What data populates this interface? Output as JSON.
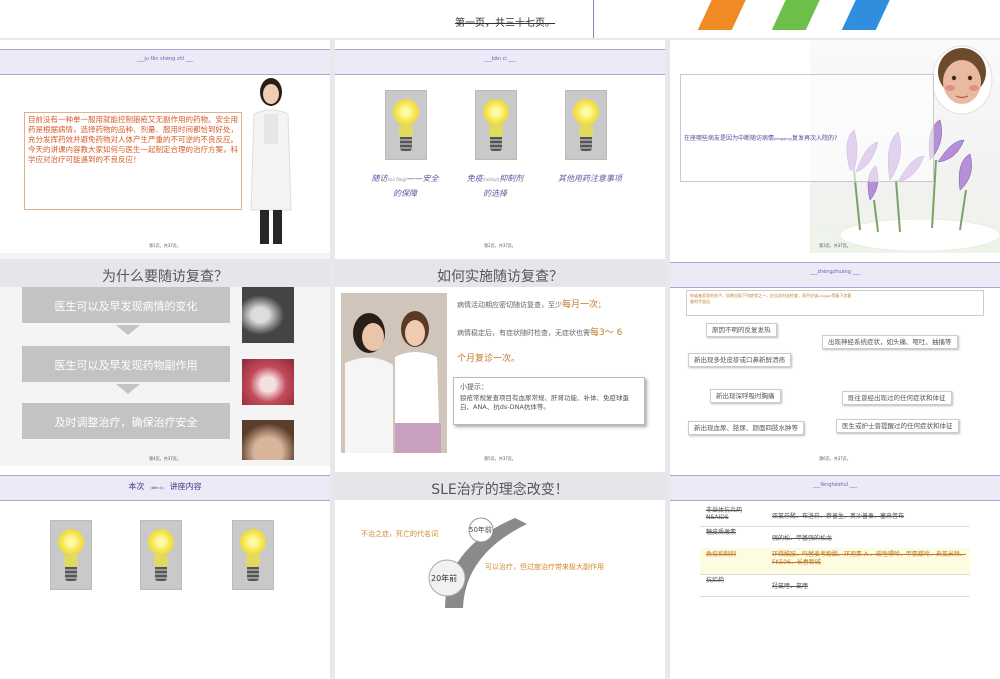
{
  "top": {
    "title": "第一页，共三十七页。"
  },
  "colors": {
    "accent_purple": "#6b63b0",
    "band": "#eceaf6",
    "orange": "#f08a24",
    "green": "#6cc04a",
    "blue": "#2f8fde",
    "text_orange": "#c27a2a"
  },
  "slide1": {
    "header": "___ju fǎn shèng zhǐ ___",
    "body": "目前没有一种单一服用就能控制狼疮又无副作用的药物。安全用药是根据病情，选择药物的品种、剂量、服用时间都恰到好处，充分发挥药效并避免药物对人体产生严重的不可逆的不良反应。今天的讲课内容教大家如何与医生一起制定合理的治疗方案，科学应对治疗可能遇到的不良反应！",
    "page": "第1页，共37页。"
  },
  "slide2": {
    "header": "___bān cì ___",
    "items": [
      {
        "text": "随访",
        "pinyin": "(suí fǎng)",
        "rest": "——安全",
        "line2": "的保障"
      },
      {
        "text": "免疫",
        "pinyin": "(miǎnyì)",
        "rest": "抑制剂",
        "line2": "的选择"
      },
      {
        "text": "其他用药注意事项",
        "pinyin": "",
        "rest": "",
        "line2": ""
      }
    ],
    "page": "第2页，共37页。"
  },
  "slide3": {
    "main": "在座哪些病友是因为中断随访病情",
    "pinyin": "(bìngqíng)",
    "tail": "复发再次入院的?",
    "page": "第3页，共37页。"
  },
  "slide4": {
    "title": "为什么要随访复查？",
    "boxes": [
      "医生可以及早发现病情的变化",
      "医生可以及早发现药物副作用",
      "及时调整治疗，确保治疗安全"
    ],
    "page": "第4页，共37页。"
  },
  "slide5": {
    "title": "如何实施随访复查？",
    "line1a": "病情活动期应密切随访复查，至少",
    "line1b": "每月一次",
    "line1c": "；",
    "line2a": "病情稳定后，有症状随时检查，无症状也需",
    "line2b": "每3～ 6",
    "line3": "个月复诊一次。",
    "tip_title": "小提示：",
    "tip_body": "狼疮常规复查项目有血尿常规、肝肾功能、补体、免疫球蛋白、ANA、抗ds-DNA抗体等。",
    "page": "第5页，共37页。"
  },
  "slide6": {
    "header": "___zhèngzhuàng ___",
    "note_top": "你或者家里的孩子，如果出现下列症状之一，应当及时去检查，而不应该",
    "note_pinyin": "(yīnggāi)",
    "note_tail": "等复下次复",
    "note_line2": "查时才说出",
    "symptoms": [
      "原因不明的反复发热",
      "出现神经系统症状，如头痛、呕吐、抽搐等",
      "新出现多处皮疹或口鼻新鲜溃疡",
      "新出现深呼吸时胸痛",
      "既往曾经出现过的任何症状和体征",
      "新出现血尿、脓尿、颜面四肢水肿等",
      "医生或护士曾提醒过的任何症状和体征"
    ],
    "page": "第6页，共37页。"
  },
  "slide7": {
    "title_a": "本次",
    "title_pinyin": "(běn cì)",
    "title_b": "讲座内容"
  },
  "slide8": {
    "title": "SLE治疗的理念改变！",
    "left_text": "不治之症，死亡的代名词",
    "badge_50": "50年前",
    "badge_20": "20年前",
    "right_text": "可以治疗，但过度治疗带来极大副作用"
  },
  "slide9": {
    "header": "___fēnghéshuǐ ___",
    "rows": [
      {
        "c1": "非甾体抗炎药NSAIDS",
        "c2": "双氯芬酸、布洛芬、萘普生、奥沙普秦、塞来昔布",
        "hl": false
      },
      {
        "c1": "糖皮质激素",
        "c2": "强的松、甲基强的松龙",
        "hl": false
      },
      {
        "c1": "免疫抑制剂",
        "c2": "环磷酰胺、吗替麦考酚酯、环孢素 A 、硫唑嘌呤、甲氨蝶呤、来氟米特、FK506、长春新碱",
        "hl": true
      },
      {
        "c1": "抗疟药",
        "c2": "羟氯喹、氯喹",
        "hl": false
      }
    ]
  }
}
